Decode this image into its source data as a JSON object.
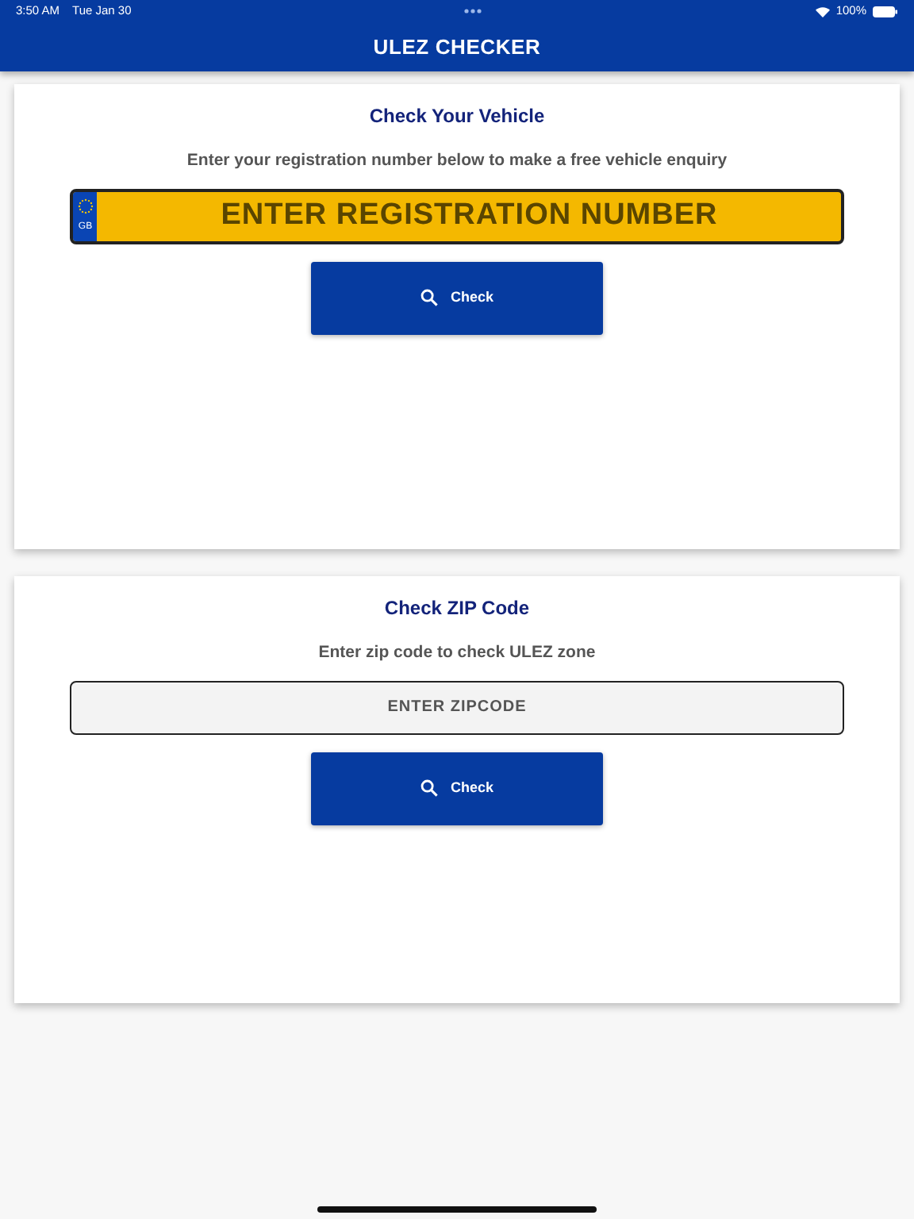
{
  "status_bar": {
    "time": "3:50 AM",
    "date": "Tue Jan 30",
    "battery": "100%"
  },
  "header": {
    "title": "ULEZ CHECKER"
  },
  "cards": [
    {
      "kind": "plate",
      "title": "Check Your Vehicle",
      "subtitle": "Enter your registration number below to make a free vehicle enquiry",
      "placeholder": "ENTER REGISTRATION NUMBER",
      "country": "GB",
      "button": "Check"
    },
    {
      "kind": "zip",
      "title": "Check ZIP Code",
      "subtitle": "Enter zip code to check ULEZ zone",
      "placeholder": "ENTER ZIPCODE",
      "button": "Check"
    }
  ]
}
